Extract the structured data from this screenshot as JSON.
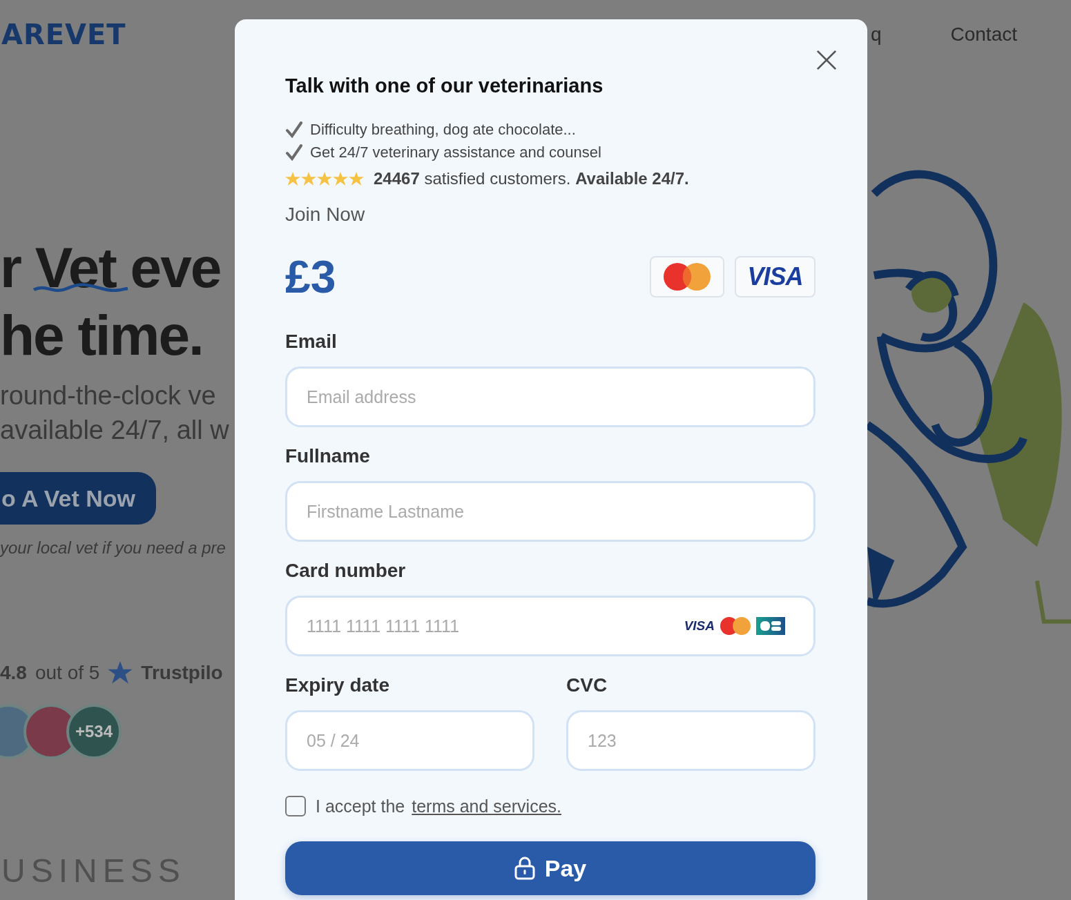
{
  "background_page": {
    "logo": "AREVET",
    "nav": [
      {
        "label": "q"
      },
      {
        "label": "Contact"
      }
    ],
    "headline": {
      "line1_before": "r",
      "line1_highlight": "Vet",
      "line1_after": "eve",
      "line2": "he time."
    },
    "subtitle": [
      "round-the-clock ve",
      "available 24/7, all w"
    ],
    "cta_button": "o A Vet Now",
    "note": "your local vet if you need a pre",
    "rating": {
      "score": "4.8",
      "text": "out of 5",
      "brand": "Trustpilo"
    },
    "avatar_count": "+534",
    "press_logo": "USINESS"
  },
  "modal": {
    "title": "Talk with one of our veterinarians",
    "checklist": [
      "Difficulty breathing, dog ate chocolate...",
      "Get 24/7 veterinary assistance and counsel"
    ],
    "stars": 5,
    "rating_text": "**24467** satisfied customers. **Available 24/7.**",
    "join_label": "Join Now",
    "price": "£3",
    "payment_badges": [
      {
        "kind": "mastercard"
      },
      {
        "kind": "visa",
        "text": "VISA"
      }
    ],
    "fields": [
      {
        "kind": "text",
        "label": "Email",
        "placeholder": "Email address"
      },
      {
        "kind": "text",
        "label": "Fullname",
        "placeholder": "Firstname Lastname"
      },
      {
        "kind": "card",
        "label": "Card number",
        "placeholder": "1111 1111 1111 1111",
        "card_icons": [
          {
            "kind": "visa",
            "text": "VISA"
          },
          {
            "kind": "mastercard"
          },
          {
            "kind": "cb"
          }
        ]
      }
    ],
    "split_fields": [
      {
        "label": "Expiry date",
        "placeholder": "05 / 24"
      },
      {
        "label": "CVC",
        "placeholder": "123"
      }
    ],
    "terms": {
      "checked": false,
      "text": "I accept the",
      "link": "terms and services."
    },
    "pay_button": "Pay"
  }
}
